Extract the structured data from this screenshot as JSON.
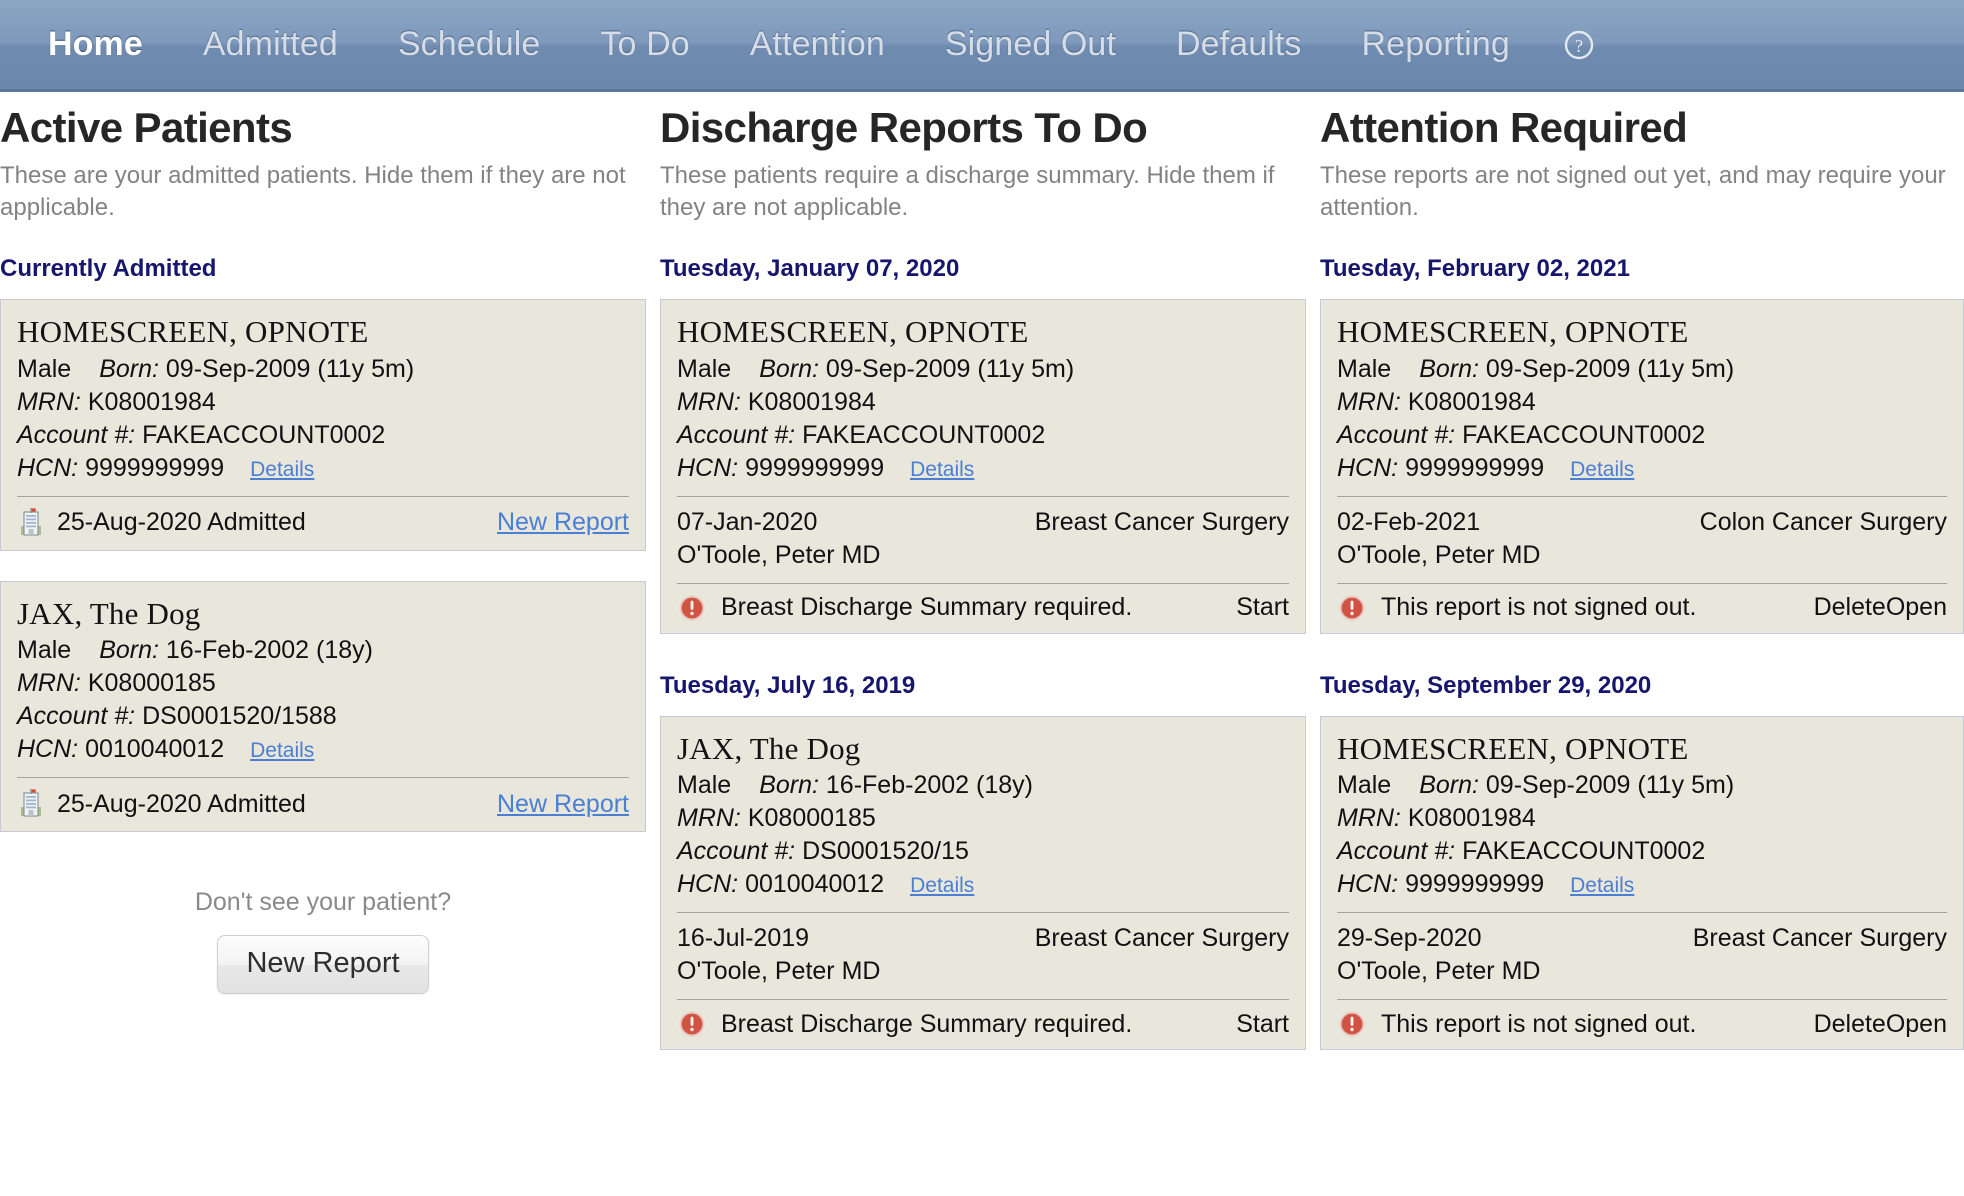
{
  "nav": {
    "items": [
      {
        "label": "Home",
        "active": true
      },
      {
        "label": "Admitted",
        "active": false
      },
      {
        "label": "Schedule",
        "active": false
      },
      {
        "label": "To Do",
        "active": false
      },
      {
        "label": "Attention",
        "active": false
      },
      {
        "label": "Signed Out",
        "active": false
      },
      {
        "label": "Defaults",
        "active": false
      },
      {
        "label": "Reporting",
        "active": false
      }
    ],
    "help_icon": "help-circle-icon"
  },
  "colors": {
    "nav_bg": "#7e99bb",
    "card_bg": "#e9e6dc",
    "card_border": "#c7c8da",
    "date_heading": "#16166e",
    "link": "#4a7fd4",
    "danger": "#f42f1a",
    "alert": "#d9534f"
  },
  "columns": [
    {
      "id": "active-patients",
      "title": "Active Patients",
      "description": "These are your admitted patients. Hide them if they are not applicable.",
      "groups": [
        {
          "heading": "Currently Admitted",
          "cards": [
            {
              "name": "HOMESCREEN, OPNOTE",
              "sex": "Male",
              "born_label": "Born:",
              "born_value": "09-Sep-2009 (11y 5m)",
              "mrn_label": "MRN:",
              "mrn_value": "K08001984",
              "account_label": "Account #:",
              "account_value": "FAKEACCOUNT0002",
              "hcn_label": "HCN:",
              "hcn_value": "9999999999",
              "details_link": "Details",
              "footer_icon": "hospital-icon",
              "footer_text": "25-Aug-2020 Admitted",
              "footer_link": "New Report"
            },
            {
              "name": "JAX, The Dog",
              "sex": "Male",
              "born_label": "Born:",
              "born_value": "16-Feb-2002 (18y)",
              "mrn_label": "MRN:",
              "mrn_value": "K08000185",
              "account_label": "Account #:",
              "account_value": "DS0001520/1588",
              "hcn_label": "HCN:",
              "hcn_value": "0010040012",
              "details_link": "Details",
              "footer_icon": "hospital-icon",
              "footer_text": "25-Aug-2020 Admitted",
              "footer_link": "New Report"
            }
          ]
        }
      ],
      "prompt": {
        "text": "Don't see your patient?",
        "button_label": "New Report"
      }
    },
    {
      "id": "discharge-reports-todo",
      "title": "Discharge Reports To Do",
      "description": "These patients require a discharge summary. Hide them if they are not applicable.",
      "groups": [
        {
          "heading": "Tuesday, January 07, 2020",
          "cards": [
            {
              "name": "HOMESCREEN, OPNOTE",
              "sex": "Male",
              "born_label": "Born:",
              "born_value": "09-Sep-2009 (11y 5m)",
              "mrn_label": "MRN:",
              "mrn_value": "K08001984",
              "account_label": "Account #:",
              "account_value": "FAKEACCOUNT0002",
              "hcn_label": "HCN:",
              "hcn_value": "9999999999",
              "details_link": "Details",
              "report_date": "07-Jan-2020",
              "procedure": "Breast Cancer Surgery",
              "surgeon": "O'Toole, Peter MD",
              "alert_icon": "alert-circle-icon",
              "alert_text": "Breast Discharge Summary required.",
              "action_primary": "Start"
            }
          ]
        },
        {
          "heading": "Tuesday, July 16, 2019",
          "cards": [
            {
              "name": "JAX, The Dog",
              "sex": "Male",
              "born_label": "Born:",
              "born_value": "16-Feb-2002 (18y)",
              "mrn_label": "MRN:",
              "mrn_value": "K08000185",
              "account_label": "Account #:",
              "account_value": "DS0001520/15",
              "hcn_label": "HCN:",
              "hcn_value": "0010040012",
              "details_link": "Details",
              "report_date": "16-Jul-2019",
              "procedure": "Breast Cancer Surgery",
              "surgeon": "O'Toole, Peter MD",
              "alert_icon": "alert-circle-icon",
              "alert_text": "Breast Discharge Summary required.",
              "action_primary": "Start"
            }
          ]
        }
      ]
    },
    {
      "id": "attention-required",
      "title": "Attention Required",
      "description": "These reports are not signed out yet, and may require your attention.",
      "groups": [
        {
          "heading": "Tuesday, February 02, 2021",
          "cards": [
            {
              "name": "HOMESCREEN, OPNOTE",
              "sex": "Male",
              "born_label": "Born:",
              "born_value": "09-Sep-2009 (11y 5m)",
              "mrn_label": "MRN:",
              "mrn_value": "K08001984",
              "account_label": "Account #:",
              "account_value": "FAKEACCOUNT0002",
              "hcn_label": "HCN:",
              "hcn_value": "9999999999",
              "details_link": "Details",
              "report_date": "02-Feb-2021",
              "procedure": "Colon Cancer Surgery",
              "surgeon": "O'Toole, Peter MD",
              "alert_icon": "alert-circle-icon",
              "alert_text": "This report is not signed out.",
              "action_danger": "Delete",
              "action_primary": "Open"
            }
          ]
        },
        {
          "heading": "Tuesday, September 29, 2020",
          "cards": [
            {
              "name": "HOMESCREEN, OPNOTE",
              "sex": "Male",
              "born_label": "Born:",
              "born_value": "09-Sep-2009 (11y 5m)",
              "mrn_label": "MRN:",
              "mrn_value": "K08001984",
              "account_label": "Account #:",
              "account_value": "FAKEACCOUNT0002",
              "hcn_label": "HCN:",
              "hcn_value": "9999999999",
              "details_link": "Details",
              "report_date": "29-Sep-2020",
              "procedure": "Breast Cancer Surgery",
              "surgeon": "O'Toole, Peter MD",
              "alert_icon": "alert-circle-icon",
              "alert_text": "This report is not signed out.",
              "action_danger": "Delete",
              "action_primary": "Open"
            }
          ]
        }
      ]
    }
  ]
}
